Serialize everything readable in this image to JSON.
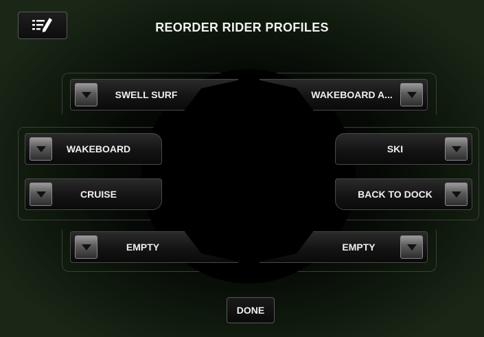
{
  "header": {
    "title": "REORDER RIDER PROFILES",
    "edit_icon": "edit-list-icon"
  },
  "slots": {
    "top_left": "SWELL SURF",
    "top_right": "WAKEBOARD A...",
    "mid_left_1": "WAKEBOARD",
    "mid_left_2": "CRUISE",
    "mid_right_1": "SKI",
    "mid_right_2": "BACK TO DOCK",
    "bottom_left": "EMPTY",
    "bottom_right": "EMPTY"
  },
  "footer": {
    "done_label": "DONE"
  }
}
